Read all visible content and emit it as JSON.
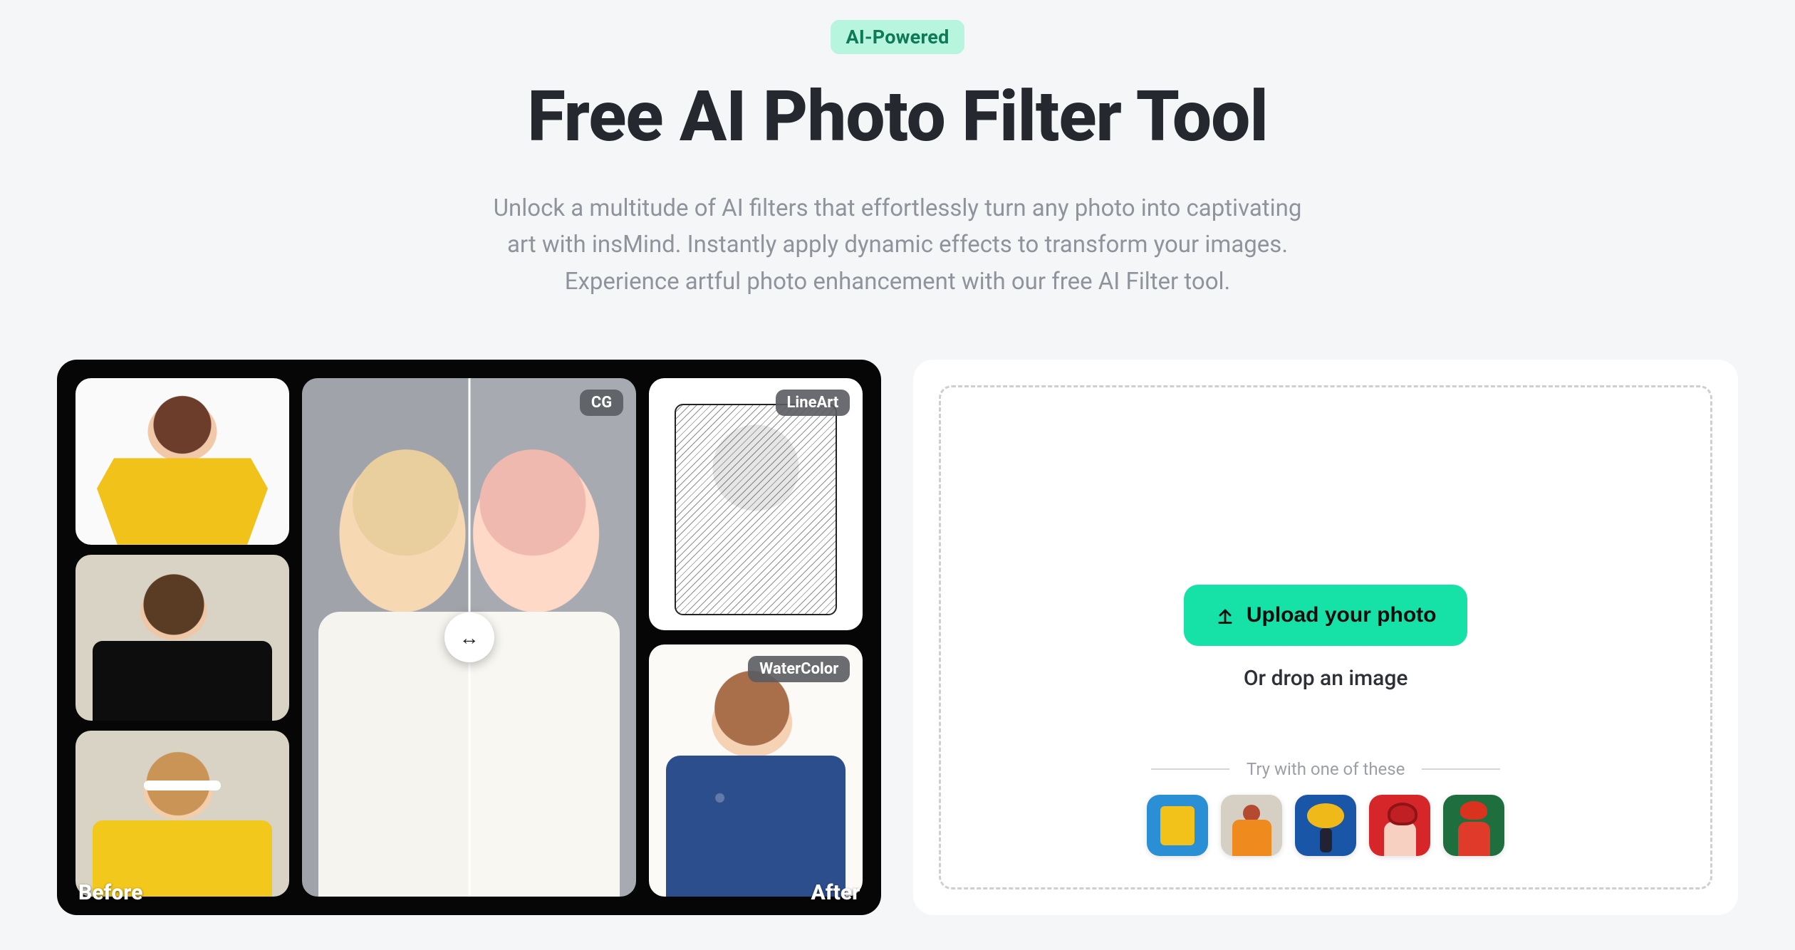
{
  "header": {
    "badge": "AI-Powered",
    "title": "Free AI Photo Filter Tool",
    "subtitle": "Unlock a multitude of AI filters that effortlessly turn any photo into captivating art with insMind. Instantly apply dynamic effects to transform your images. Experience artful photo enhancement with our free AI Filter tool."
  },
  "showcase": {
    "before_label": "Before",
    "after_label": "After",
    "compare_tag": "CG",
    "filters": {
      "lineart": "LineArt",
      "watercolor": "WaterColor"
    }
  },
  "upload": {
    "button_label": "Upload your photo",
    "drop_label": "Or drop an image",
    "samples_label": "Try with one of these"
  }
}
